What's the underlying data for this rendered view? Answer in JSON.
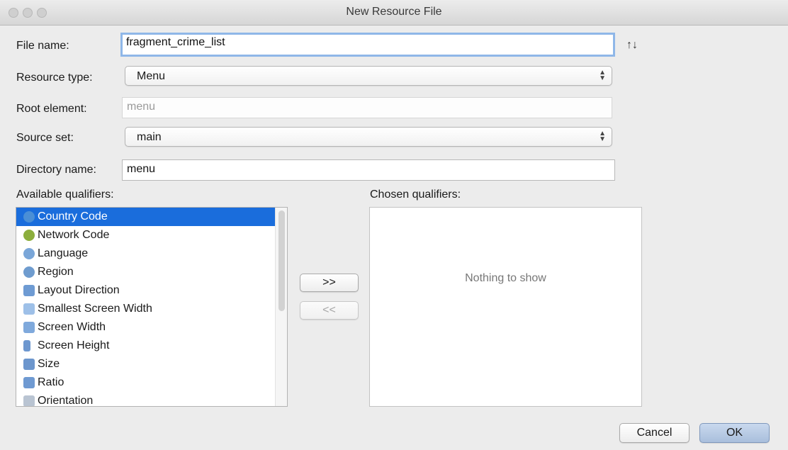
{
  "window": {
    "title": "New Resource File"
  },
  "fields": {
    "file_name_label": "File name:",
    "file_name_value": "fragment_crime_list",
    "resource_type_label": "Resource type:",
    "resource_type_value": "Menu",
    "root_element_label": "Root element:",
    "root_element_value": "menu",
    "source_set_label": "Source set:",
    "source_set_value": "main",
    "directory_name_label": "Directory name:",
    "directory_name_value": "menu"
  },
  "qualifiers": {
    "available_label": "Available qualifiers:",
    "chosen_label": "Chosen qualifiers:",
    "available": [
      {
        "label": "Country Code",
        "icon": "country-code-icon",
        "selected": true
      },
      {
        "label": "Network Code",
        "icon": "network-code-icon"
      },
      {
        "label": "Language",
        "icon": "language-icon"
      },
      {
        "label": "Region",
        "icon": "region-icon"
      },
      {
        "label": "Layout Direction",
        "icon": "layout-direction-icon"
      },
      {
        "label": "Smallest Screen Width",
        "icon": "smallest-screen-width-icon"
      },
      {
        "label": "Screen Width",
        "icon": "screen-width-icon"
      },
      {
        "label": "Screen Height",
        "icon": "screen-height-icon"
      },
      {
        "label": "Size",
        "icon": "size-icon"
      },
      {
        "label": "Ratio",
        "icon": "ratio-icon"
      },
      {
        "label": "Orientation",
        "icon": "orientation-icon"
      }
    ],
    "add_label": ">>",
    "remove_label": "<<",
    "empty_text": "Nothing to show"
  },
  "buttons": {
    "cancel": "Cancel",
    "ok": "OK"
  },
  "colors": {
    "selection": "#1a6ddc",
    "focus_ring": "#8fb7e8",
    "background": "#ececec"
  }
}
